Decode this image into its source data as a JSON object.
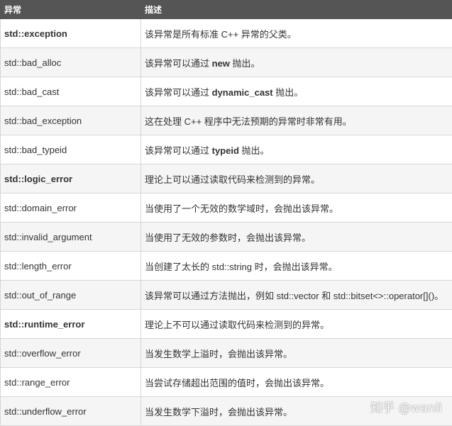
{
  "table": {
    "headers": [
      "异常",
      "描述"
    ],
    "rows": [
      {
        "name": "std::exception",
        "bold": true,
        "desc": [
          {
            "t": "该异常是所有标准 C++ 异常的父类。"
          }
        ]
      },
      {
        "name": "std::bad_alloc",
        "bold": false,
        "desc": [
          {
            "t": "该异常可以通过 "
          },
          {
            "t": "new",
            "b": true
          },
          {
            "t": " 抛出。"
          }
        ]
      },
      {
        "name": "std::bad_cast",
        "bold": false,
        "desc": [
          {
            "t": "该异常可以通过 "
          },
          {
            "t": "dynamic_cast",
            "b": true
          },
          {
            "t": " 抛出。"
          }
        ]
      },
      {
        "name": "std::bad_exception",
        "bold": false,
        "desc": [
          {
            "t": "这在处理 C++ 程序中无法预期的异常时非常有用。"
          }
        ]
      },
      {
        "name": "std::bad_typeid",
        "bold": false,
        "desc": [
          {
            "t": "该异常可以通过 "
          },
          {
            "t": "typeid",
            "b": true
          },
          {
            "t": " 抛出。"
          }
        ]
      },
      {
        "name": "std::logic_error",
        "bold": true,
        "desc": [
          {
            "t": "理论上可以通过读取代码来检测到的异常。"
          }
        ]
      },
      {
        "name": "std::domain_error",
        "bold": false,
        "desc": [
          {
            "t": "当使用了一个无效的数学域时，会抛出该异常。"
          }
        ]
      },
      {
        "name": "std::invalid_argument",
        "bold": false,
        "desc": [
          {
            "t": "当使用了无效的参数时，会抛出该异常。"
          }
        ]
      },
      {
        "name": "std::length_error",
        "bold": false,
        "desc": [
          {
            "t": "当创建了太长的 std::string 时，会抛出该异常。"
          }
        ]
      },
      {
        "name": "std::out_of_range",
        "bold": false,
        "desc": [
          {
            "t": "该异常可以通过方法抛出，例如 std::vector 和 std::bitset<>::operator[]()。"
          }
        ]
      },
      {
        "name": "std::runtime_error",
        "bold": true,
        "desc": [
          {
            "t": "理论上不可以通过读取代码来检测到的异常。"
          }
        ]
      },
      {
        "name": "std::overflow_error",
        "bold": false,
        "desc": [
          {
            "t": "当发生数学上溢时，会抛出该异常。"
          }
        ]
      },
      {
        "name": "std::range_error",
        "bold": false,
        "desc": [
          {
            "t": "当尝试存储超出范围的值时，会抛出该异常。"
          }
        ]
      },
      {
        "name": "std::underflow_error",
        "bold": false,
        "desc": [
          {
            "t": "当发生数学下溢时，会抛出该异常。"
          }
        ]
      }
    ]
  },
  "watermark": "知乎 @wanli"
}
